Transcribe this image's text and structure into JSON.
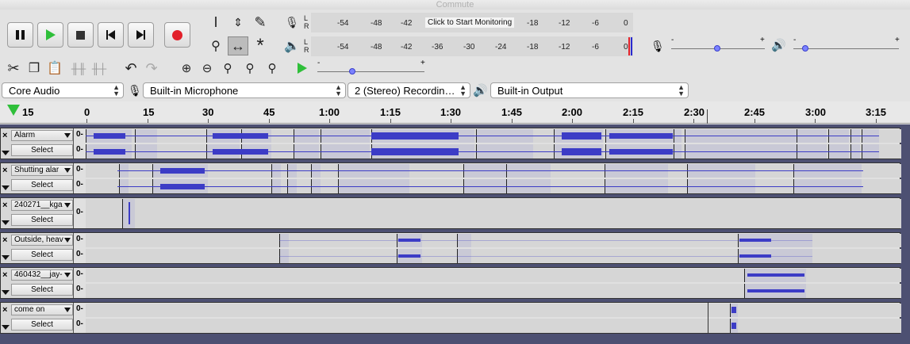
{
  "window": {
    "title": "Commute"
  },
  "transport": {
    "pause": "pause-icon",
    "play": "play-icon",
    "stop": "stop-icon",
    "skip_start": "skip-start-icon",
    "skip_end": "skip-end-icon",
    "record": "record-icon",
    "colors": {
      "play": "#2fbf3a",
      "record": "#e2202a"
    }
  },
  "meters": {
    "lr_left": "L",
    "lr_right": "R",
    "record_ticks": [
      "-54",
      "-48",
      "-42",
      "-18",
      "-12",
      "-6",
      "0"
    ],
    "monitor_label": "Click to Start Monitoring",
    "playback_ticks": [
      "-54",
      "-48",
      "-42",
      "-36",
      "-30",
      "-24",
      "-18",
      "-12",
      "-6",
      "0"
    ]
  },
  "mixer": {
    "minus": "-",
    "plus": "+"
  },
  "devices": {
    "host": "Core Audio",
    "input": "Built-in Microphone",
    "channels": "2 (Stereo) Recordin…",
    "output": "Built-in Output"
  },
  "timeline": {
    "ticks": [
      "15",
      "0",
      "15",
      "30",
      "45",
      "1:00",
      "1:15",
      "1:30",
      "1:45",
      "2:00",
      "2:15",
      "2:30",
      "2:45",
      "3:00",
      "3:15"
    ]
  },
  "tracks": [
    {
      "name": "Alarm",
      "select": "Select",
      "scale": "0-"
    },
    {
      "name": "Shutting alar",
      "select": "Select",
      "scale": "0-"
    },
    {
      "name": "240271__kga",
      "select": "Select",
      "scale": "0-"
    },
    {
      "name": "Outside, heav",
      "select": "Select",
      "scale": "0-"
    },
    {
      "name": "460432__jay-",
      "select": "Select",
      "scale": "0-"
    },
    {
      "name": "come on",
      "select": "Select",
      "scale": "0-"
    }
  ],
  "colors": {
    "waveform": "#3c3cc6",
    "track_bg": "#4d5072",
    "clip": "#c9c9d6"
  }
}
